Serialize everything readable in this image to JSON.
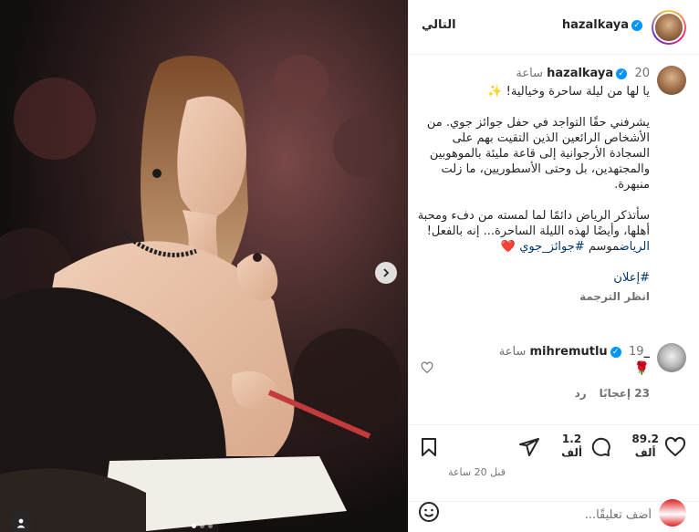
{
  "header": {
    "username": "hazalkaya",
    "follow_label": "التالي"
  },
  "caption": {
    "username": "hazalkaya",
    "time": "20 ساعة",
    "line1": "يا لها من ليلة ساحرة وخيالية! ✨",
    "para1": "يشرفني حقًا التواجد في حفل جوائز جوي. من الأشخاص الرائعين الذين التقيت بهم على السجادة الأرجوانية إلى قاعة مليئة بالموهوبين والمجتهدين، بل وحتى الأسطوريين، ما زلت منبهرة.",
    "para2_a": "سأتذكر الرياض دائمًا لما لمسته من دفء ومحبة أهلها، وأيضًا لهذه الليلة الساحرة... إنه بالفعل!",
    "para2_link1": "الرياض",
    "para2_b": "موسم",
    "para2_link2": "#جوائز_جوي",
    "para2_heart": "❤️",
    "hashtag": "#إعلان",
    "translate": "انظر الترجمة"
  },
  "comment": {
    "username": "_mihremutlu",
    "time": "19 ساعة",
    "text": "🌹",
    "likes": "23 إعجابًا",
    "reply": "رد"
  },
  "actions": {
    "likes_count": "89.2",
    "likes_unit": "ألف",
    "comments_count": "1.2",
    "comments_unit": "ألف",
    "post_time": "قبل 20 ساعة"
  },
  "add_comment": {
    "placeholder": "أضف تعليقًا..."
  },
  "carousel": {
    "total_slides": 3,
    "current_slide": 1
  },
  "colors": {
    "verified": "#0095f6",
    "link": "#00376b",
    "muted": "#737373",
    "heart_red": "#ed4956"
  }
}
